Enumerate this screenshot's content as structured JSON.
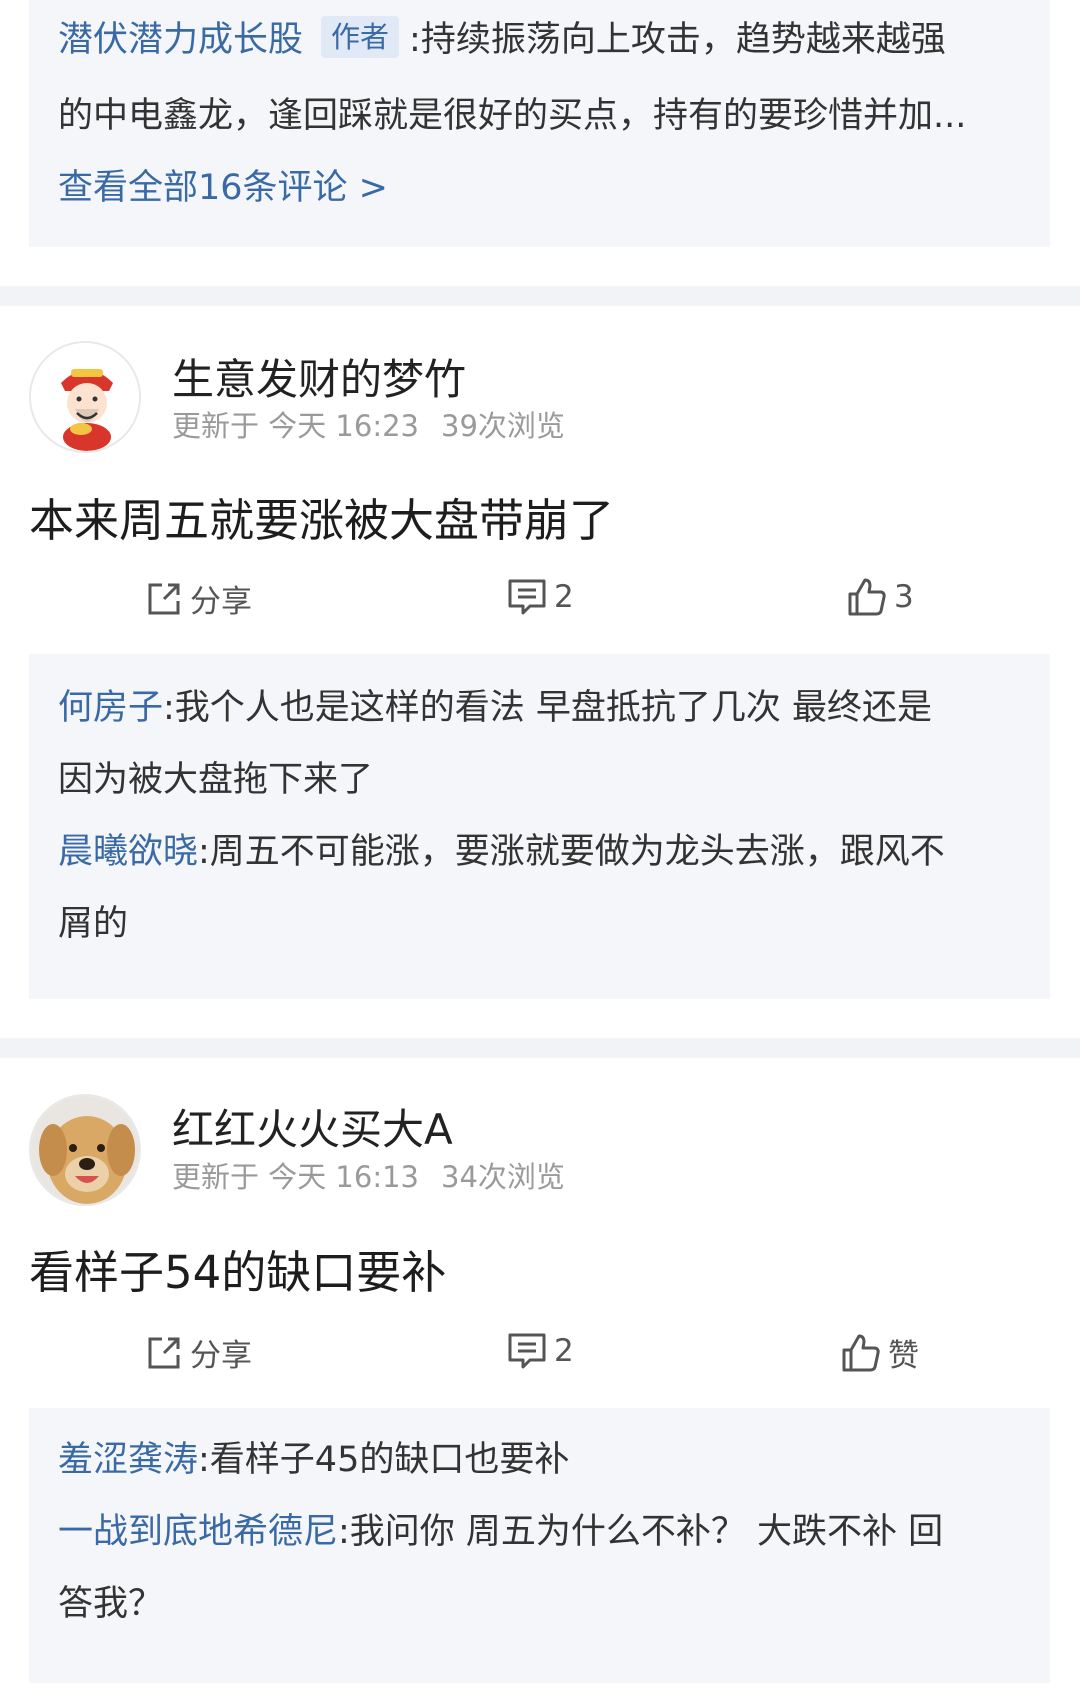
{
  "top_comments": {
    "line1": {
      "name": "潜伏潜力成长股",
      "tag": "作者",
      "text": ":持续振荡向上攻击，趋势越来越强"
    },
    "line2": {
      "text": "的中电鑫龙，逢回踩就是很好的买点，持有的要珍惜并加..."
    },
    "view_all": "查看全部16条评论 >"
  },
  "posts": [
    {
      "user": "生意发财的梦竹",
      "updated": "更新于 今天 16:23",
      "views": "39次浏览",
      "content": "本来周五就要涨被大盘带崩了",
      "share_label": "分享",
      "comment_count": "2",
      "like_label": "3",
      "comments": [
        {
          "name": "何房子",
          "text_line1": ":我个人也是这样的看法 早盘抵抗了几次 最终还是",
          "text_line2": "因为被大盘拖下来了"
        },
        {
          "name": "晨曦欲晓",
          "text_line1": ":周五不可能涨，要涨就要做为龙头去涨，跟风不",
          "text_line2": "屑的"
        }
      ]
    },
    {
      "user": "红红火火买大A",
      "updated": "更新于 今天 16:13",
      "views": "34次浏览",
      "content": "看样子54的缺口要补",
      "share_label": "分享",
      "comment_count": "2",
      "like_label": "赞",
      "comments": [
        {
          "name": "羞涩龚涛",
          "text_line1": ":看样子45的缺口也要补"
        },
        {
          "name": "一战到底地希德尼",
          "text_line1": ":我问你 周五为什么不补？ 大跌不补 回",
          "text_line2": "答我？"
        }
      ]
    }
  ],
  "icons": {
    "share": "share-icon",
    "comment": "comment-icon",
    "like": "thumbs-up-icon"
  },
  "colors": {
    "link": "#3a6aa5",
    "comment_bg": "#f5f6f9",
    "divider": "#f2f3f6"
  }
}
